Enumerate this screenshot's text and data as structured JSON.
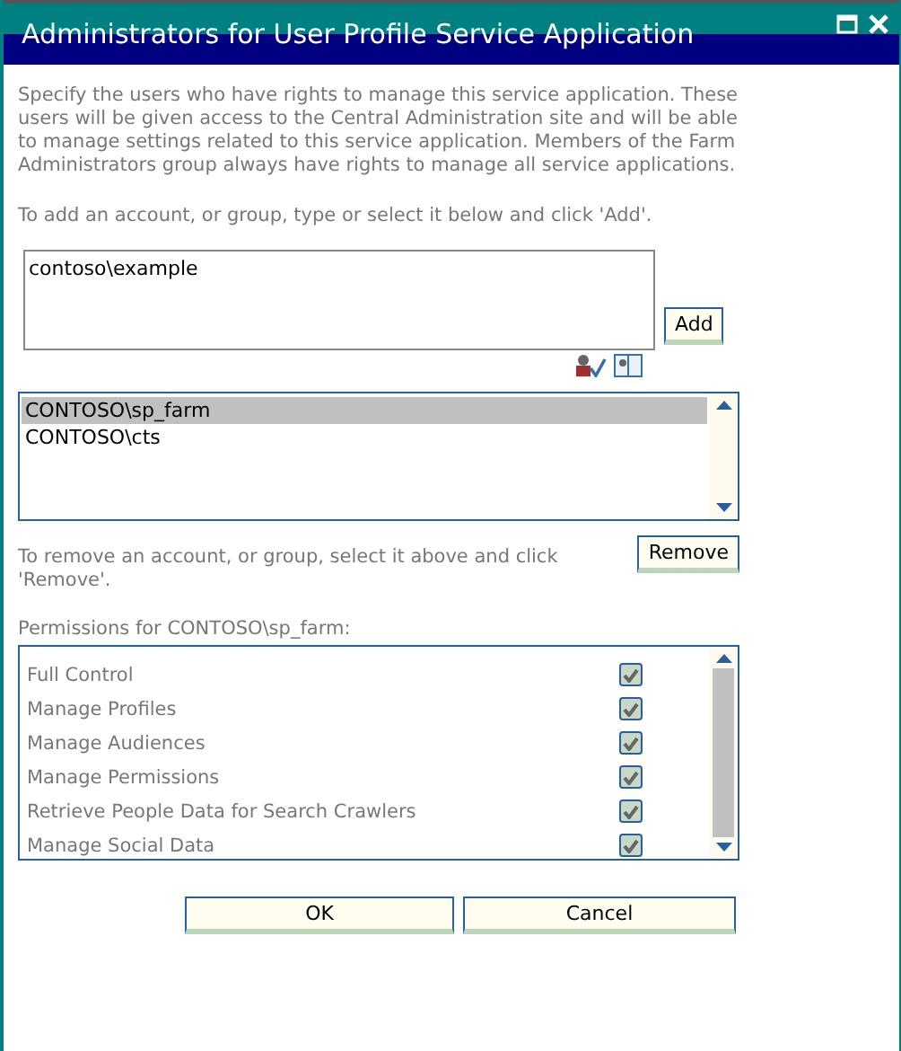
{
  "window": {
    "title": "Administrators for User Profile Service Application"
  },
  "description": "Specify the users who have rights to manage this service application. These users will be given access to the Central Administration site and will be able to manage settings related to this service application. Members of the Farm Administrators group always have rights to manage all service applications.",
  "add_instruction": "To add an account, or group, type or select it below and click 'Add'.",
  "people_picker": {
    "value": "contoso\\example"
  },
  "add_button": "Add",
  "administrators": [
    {
      "name": "CONTOSO\\sp_farm",
      "selected": true
    },
    {
      "name": "CONTOSO\\cts",
      "selected": false
    }
  ],
  "remove_instruction": "To remove an account, or group, select it above and click 'Remove'.",
  "remove_button": "Remove",
  "permissions": {
    "label": "Permissions for CONTOSO\\sp_farm:",
    "items": [
      {
        "label": "Full Control",
        "checked": true
      },
      {
        "label": "Manage Profiles",
        "checked": true
      },
      {
        "label": "Manage Audiences",
        "checked": true
      },
      {
        "label": "Manage Permissions",
        "checked": true
      },
      {
        "label": "Retrieve People Data for Search Crawlers",
        "checked": true
      },
      {
        "label": "Manage Social Data",
        "checked": true
      }
    ]
  },
  "buttons": [
    {
      "label": "OK"
    },
    {
      "label": "Cancel"
    }
  ]
}
